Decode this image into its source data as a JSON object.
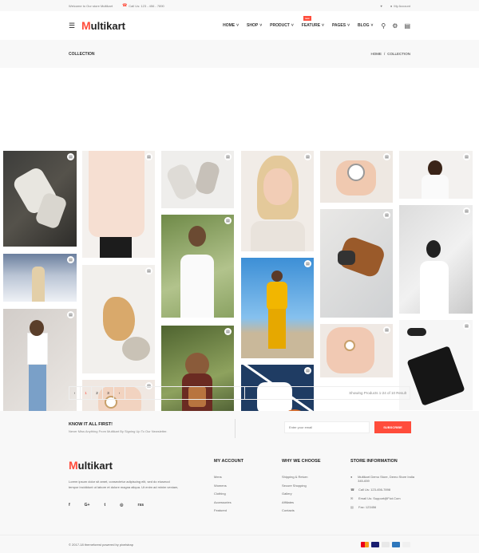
{
  "topbar": {
    "welcome": "Welcome to Our store Multikart",
    "call": "Call Us: 123 - 456 - 7890",
    "account": "My Account"
  },
  "header": {
    "logo_m": "M",
    "logo_rest": "ultikart",
    "nav": [
      {
        "label": "HOME"
      },
      {
        "label": "SHOP"
      },
      {
        "label": "PRODUCT"
      },
      {
        "label": "FEATURE",
        "badge": "new"
      },
      {
        "label": "PAGES"
      },
      {
        "label": "BLOG"
      }
    ]
  },
  "breadcrumb": {
    "title": "COLLECTION",
    "home": "HOME",
    "sep": "/",
    "current": "COLLECTION"
  },
  "gallery": {
    "tiles": [
      {
        "name": "sneakers"
      },
      {
        "name": "snow-girl"
      },
      {
        "name": "girl-leaning"
      },
      {
        "name": "white-shirt-man"
      },
      {
        "name": "gold-accessory"
      },
      {
        "name": "wrist-watch"
      },
      {
        "name": "shoes-flatlay"
      },
      {
        "name": "girl-white-top"
      },
      {
        "name": "girl-backpack"
      },
      {
        "name": "blonde-portrait"
      },
      {
        "name": "yellow-tracksuit"
      },
      {
        "name": "basketball-watch"
      },
      {
        "name": "hand-watch"
      },
      {
        "name": "bag-headphones"
      },
      {
        "name": "hand-watch-2"
      },
      {
        "name": "woman-portrait"
      },
      {
        "name": "woman-sunglasses"
      },
      {
        "name": "handbag-flatlay"
      }
    ]
  },
  "pagination": {
    "prev": "‹",
    "pages": [
      "1",
      "2",
      "3"
    ],
    "next": "›",
    "info": "Showing Products 1-24 of 10 Result"
  },
  "newsletter": {
    "title": "KNOW IT ALL FIRST!",
    "text": "Never Miss Anything From Multikart By Signing Up To Our Newsletter.",
    "placeholder": "Enter your email",
    "button": "SUBSCRIBE"
  },
  "footer": {
    "logo_m": "M",
    "logo_rest": "ultikart",
    "about": "Lorem ipsum dolor sit amet, consectetur adipiscing elit, sed do eiusmod tempor incididunt ut labore et dolore magna aliqua. Ut enim ad minim veniam,",
    "social": [
      "f",
      "G+",
      "t",
      "◎",
      "rss"
    ],
    "my_account": {
      "title": "MY ACCOUNT",
      "links": [
        "Mens",
        "Womens",
        "Clothing",
        "Accessories",
        "Featured"
      ]
    },
    "why": {
      "title": "WHY WE CHOOSE",
      "links": [
        "Shipping & Return",
        "Secure Shopping",
        "Gallery",
        "Affiliates",
        "Contacts"
      ]
    },
    "store": {
      "title": "STORE INFORMATION",
      "address": "Multikart Demo Store, Demo Store India 345-659",
      "phone": "Call Us: 123-456-7898",
      "email": "Email Us: Support@Fiot.Com",
      "fax": "Fax: 123456"
    }
  },
  "bottom": {
    "copyright": "© 2017-18 themeforest powered by pixelstrap"
  },
  "colors": {
    "accent": "#ff4c3b"
  }
}
